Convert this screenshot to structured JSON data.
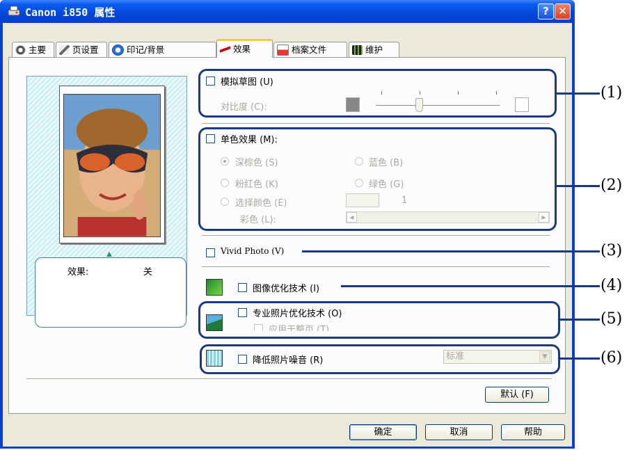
{
  "window": {
    "title": "Canon i850 属性",
    "help_label": "?",
    "close_label": "✕"
  },
  "tabs": [
    {
      "label": "主要",
      "icon": "main-icon"
    },
    {
      "label": "页设置",
      "icon": "page-setup-icon"
    },
    {
      "label": "印记/背景",
      "icon": "stamp-icon"
    },
    {
      "label": "效果",
      "icon": "effects-icon",
      "active": true
    },
    {
      "label": "档案文件",
      "icon": "profile-icon"
    },
    {
      "label": "维护",
      "icon": "maintenance-icon"
    }
  ],
  "preview": {
    "effect_label": "效果:",
    "effect_value": "关"
  },
  "simulate_sketch": {
    "label": "模拟草图 (U)",
    "checked": false,
    "contrast_label": "对比度 (C):",
    "contrast_level": 0.5
  },
  "monochrome": {
    "label": "单色效果 (M):",
    "checked": false,
    "options": [
      {
        "label": "深棕色 (S)",
        "selected": true
      },
      {
        "label": "蓝色 (B)",
        "selected": false
      },
      {
        "label": "粉红色 (K)",
        "selected": false
      },
      {
        "label": "绿色 (G)",
        "selected": false
      },
      {
        "label": "选择颜色 (E)",
        "selected": false
      }
    ],
    "color_value": "1",
    "hue_label": "彩色 (L):"
  },
  "vivid_photo": {
    "label": "Vivid Photo (V)",
    "checked": false
  },
  "image_optimizer": {
    "label": "图像优化技术 (I)",
    "checked": false
  },
  "photo_optimizer_pro": {
    "label": "专业照片优化技术 (O)",
    "checked": false,
    "sub_label": "应用于整页 (T)"
  },
  "noise_reduction": {
    "label": "降低照片噪音 (R)",
    "checked": false,
    "level": "标准"
  },
  "buttons": {
    "defaults": "默认 (F)",
    "ok": "确定",
    "cancel": "取消",
    "help": "帮助"
  },
  "callouts": [
    "(1)",
    "(2)",
    "(3)",
    "(4)",
    "(5)",
    "(6)"
  ],
  "colors": {
    "titlebar": "#0a3fd0",
    "callout": "#1a3a80",
    "active_tab_accent": "#ffc83c"
  }
}
